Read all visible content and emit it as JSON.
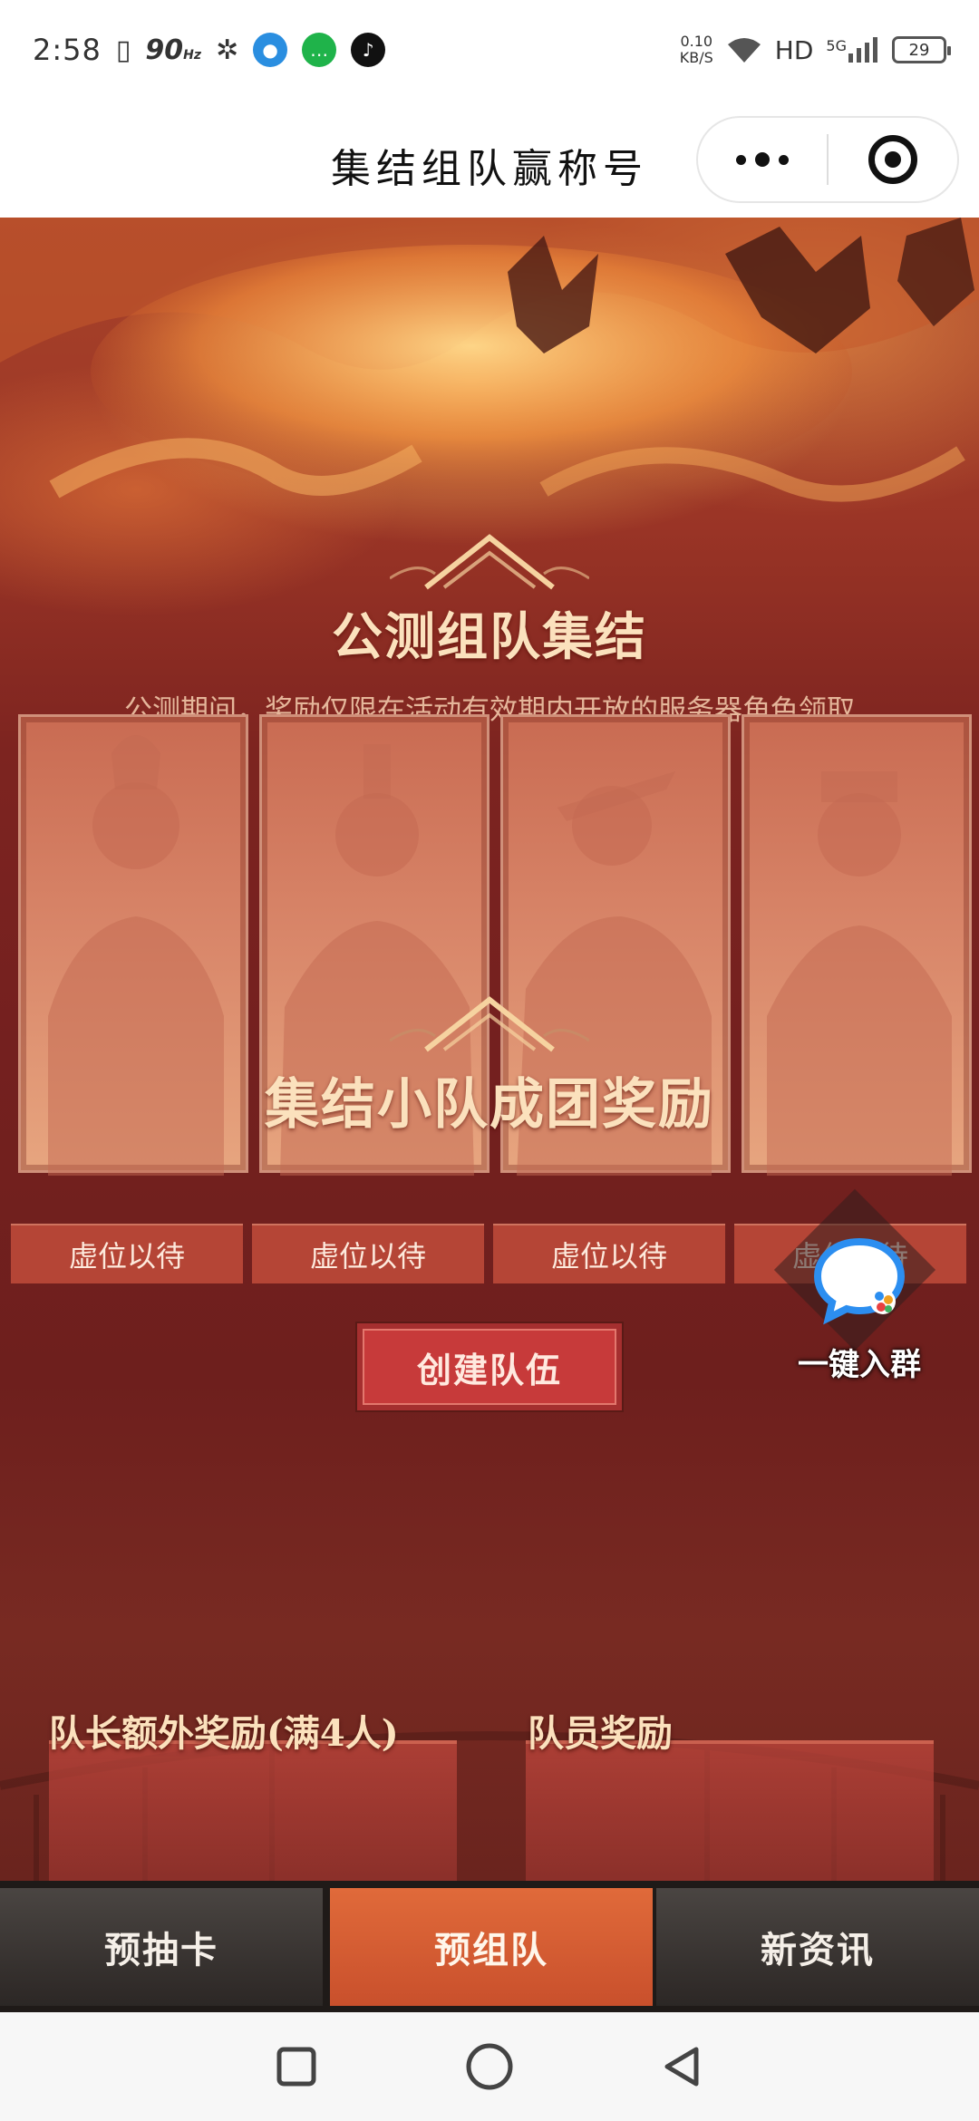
{
  "status_bar": {
    "time": "2:58",
    "refresh_rate": "90",
    "refresh_unit": "Hz",
    "net_speed_value": "0.10",
    "net_speed_unit": "KB/S",
    "network": "HD",
    "cell": "5G",
    "battery": "29"
  },
  "title_bar": {
    "title": "集结组队赢称号"
  },
  "main": {
    "section1_title": "公测组队集结",
    "section1_subtitle": "公测期间，奖励仅限在活动有效期内开放的服务器角色领取",
    "slots": [
      {
        "label": "虚位以待"
      },
      {
        "label": "虚位以待"
      },
      {
        "label": "虚位以待"
      },
      {
        "label": "虚位以待"
      }
    ],
    "create_team_button": "创建队伍",
    "join_group_label": "一键入群",
    "section2_title": "集结小队成团奖励",
    "leader_reward_label": "队长额外奖励(满4人)",
    "member_reward_label": "队员奖励"
  },
  "tabbar": {
    "tabs": [
      {
        "label": "预抽卡"
      },
      {
        "label": "预组队"
      },
      {
        "label": "新资讯"
      }
    ],
    "active_index": 1
  },
  "colors": {
    "accent": "#c73a3a",
    "tab_active": "#d95a33",
    "title_gold": "#fbe1bd"
  }
}
